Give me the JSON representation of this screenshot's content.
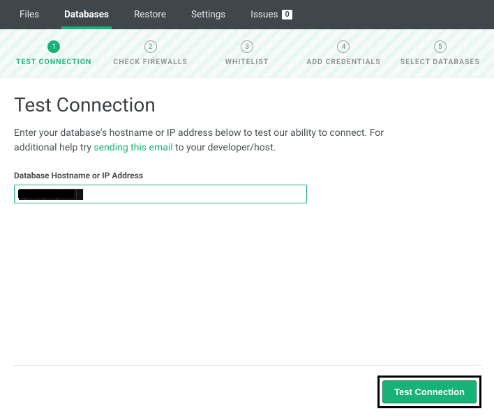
{
  "topnav": {
    "items": [
      "Files",
      "Databases",
      "Restore",
      "Settings",
      "Issues"
    ],
    "active_index": 1,
    "issues_count": "0"
  },
  "steps": {
    "items": [
      {
        "num": "1",
        "label": "TEST CONNECTION"
      },
      {
        "num": "2",
        "label": "CHECK FIREWALLS"
      },
      {
        "num": "3",
        "label": "WHITELIST"
      },
      {
        "num": "4",
        "label": "ADD CREDENTIALS"
      },
      {
        "num": "5",
        "label": "SELECT DATABASES"
      }
    ],
    "active_index": 0
  },
  "page": {
    "title": "Test Connection",
    "desc_pre": "Enter your database's hostname or IP address below to test our ability to connect. For additional help try ",
    "desc_link": "sending this email",
    "desc_post": " to your developer/host."
  },
  "form": {
    "hostname_label": "Database Hostname or IP Address",
    "hostname_value": "██████████"
  },
  "actions": {
    "test_connection": "Test Connection"
  }
}
